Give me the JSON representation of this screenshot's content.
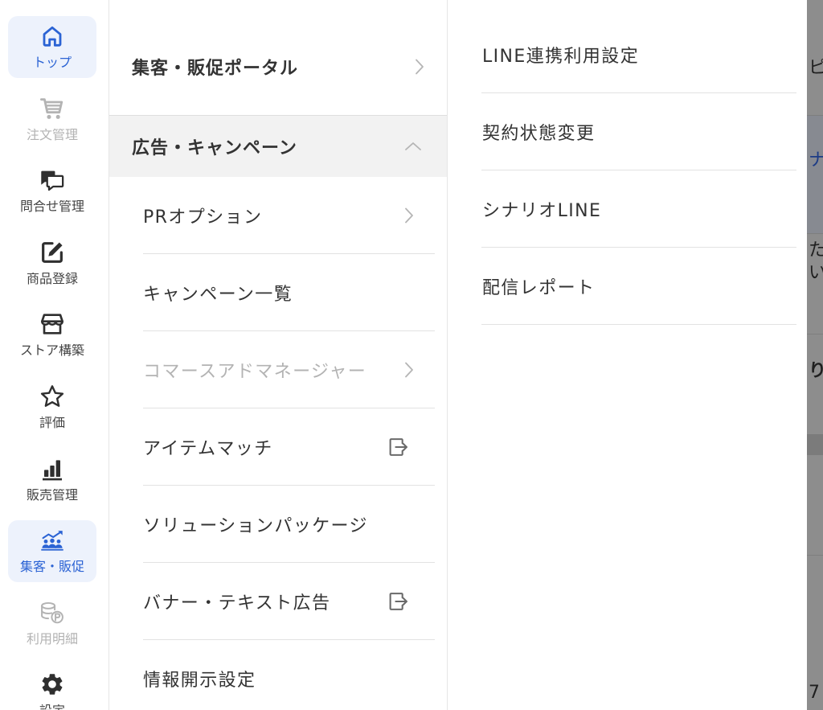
{
  "theme": {
    "accent": "#2b63d4",
    "active_bg": "#edf2fc",
    "muted": "#b3b3b3",
    "text": "#333333"
  },
  "sidebar": {
    "items": [
      {
        "label": "トップ",
        "icon": "home-icon",
        "active": true
      },
      {
        "label": "注文管理",
        "icon": "cart-icon",
        "disabled": true
      },
      {
        "label": "問合せ管理",
        "icon": "chat-icon"
      },
      {
        "label": "商品登録",
        "icon": "edit-icon"
      },
      {
        "label": "ストア構築",
        "icon": "store-icon"
      },
      {
        "label": "評価",
        "icon": "star-icon"
      },
      {
        "label": "販売管理",
        "icon": "bar-chart-icon"
      },
      {
        "label": "集客・販促",
        "icon": "promotion-icon",
        "active": true
      },
      {
        "label": "利用明細",
        "icon": "coins-icon",
        "disabled": true
      },
      {
        "label": "設定",
        "icon": "gear-icon"
      }
    ]
  },
  "menu": {
    "portal": {
      "label": "集客・販促ポータル",
      "icon": "chevron-right-icon"
    },
    "section": {
      "label": "広告・キャンペーン",
      "icon": "chevron-up-icon",
      "expanded": true
    },
    "items": [
      {
        "label": "PRオプション",
        "icon": "chevron-right-icon"
      },
      {
        "label": "キャンペーン一覧"
      },
      {
        "label": "コマースアドマネージャー",
        "icon": "chevron-right-icon",
        "disabled": true
      },
      {
        "label": "アイテムマッチ",
        "icon": "external-link-icon"
      },
      {
        "label": "ソリューションパッケージ"
      },
      {
        "label": "バナー・テキスト広告",
        "icon": "external-link-icon"
      },
      {
        "label": "情報開示設定"
      }
    ]
  },
  "submenu": {
    "items": [
      {
        "label": "LINE連携利用設定"
      },
      {
        "label": "契約状態変更"
      },
      {
        "label": "シナリオLINE"
      },
      {
        "label": "配信レポート"
      }
    ]
  },
  "backdrop": {
    "fragments": [
      "ピ",
      "ナ",
      "た",
      "い",
      "り",
      "7"
    ]
  }
}
